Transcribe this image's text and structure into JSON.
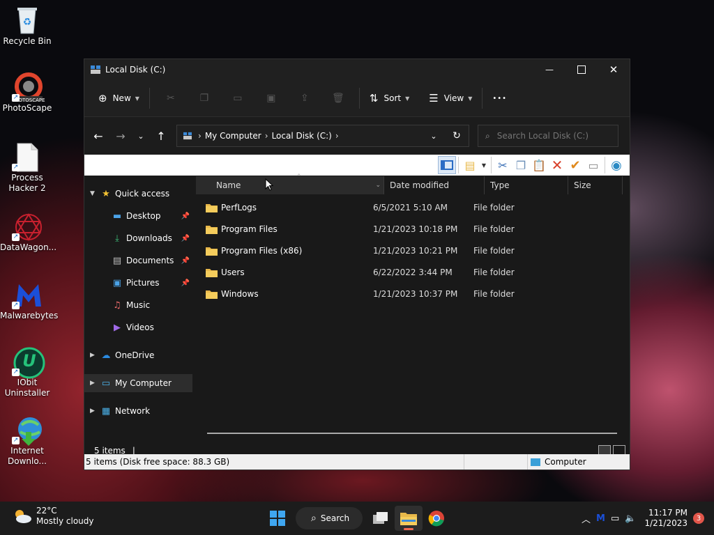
{
  "desktop": {
    "icons": [
      {
        "label": "Recycle Bin",
        "icon": "recycle-bin-icon"
      },
      {
        "label": "PhotoScape",
        "icon": "photoscape-icon",
        "badge_text": "PHOTOSCAPE"
      },
      {
        "label": "Process Hacker 2",
        "icon": "document-icon"
      },
      {
        "label": "DataWagon...",
        "icon": "datawagon-icon"
      },
      {
        "label": "Malwarebytes",
        "icon": "malwarebytes-icon"
      },
      {
        "label": "IObit Uninstaller",
        "icon": "iobit-icon",
        "glyph": "U"
      },
      {
        "label": "Internet Downlo...",
        "icon": "internet-download-icon"
      }
    ]
  },
  "window": {
    "title": "Local Disk (C:)",
    "commands": {
      "new": "New",
      "sort": "Sort",
      "view": "View",
      "more": "•••"
    },
    "address": {
      "segments": [
        "My Computer",
        "Local Disk (C:)"
      ]
    },
    "search_placeholder": "Search Local Disk (C:)",
    "nav": {
      "quick_access": "Quick access",
      "desktop": "Desktop",
      "downloads": "Downloads",
      "documents": "Documents",
      "pictures": "Pictures",
      "music": "Music",
      "videos": "Videos",
      "onedrive": "OneDrive",
      "my_computer": "My Computer",
      "network": "Network"
    },
    "columns": {
      "name": "Name",
      "date": "Date modified",
      "type": "Type",
      "size": "Size"
    },
    "files": [
      {
        "name": "PerfLogs",
        "date": "6/5/2021 5:10 AM",
        "type": "File folder"
      },
      {
        "name": "Program Files",
        "date": "1/21/2023 10:18 PM",
        "type": "File folder"
      },
      {
        "name": "Program Files (x86)",
        "date": "1/21/2023 10:21 PM",
        "type": "File folder"
      },
      {
        "name": "Users",
        "date": "6/22/2022 3:44 PM",
        "type": "File folder"
      },
      {
        "name": "Windows",
        "date": "1/21/2023 10:37 PM",
        "type": "File folder"
      }
    ],
    "items_count": "5 items",
    "status_left": "5 items (Disk free space: 88.3 GB)",
    "status_right": "Computer"
  },
  "taskbar": {
    "weather_temp": "22°C",
    "weather_desc": "Mostly cloudy",
    "search_label": "Search",
    "time": "11:17 PM",
    "date": "1/21/2023",
    "notifications": "3"
  }
}
